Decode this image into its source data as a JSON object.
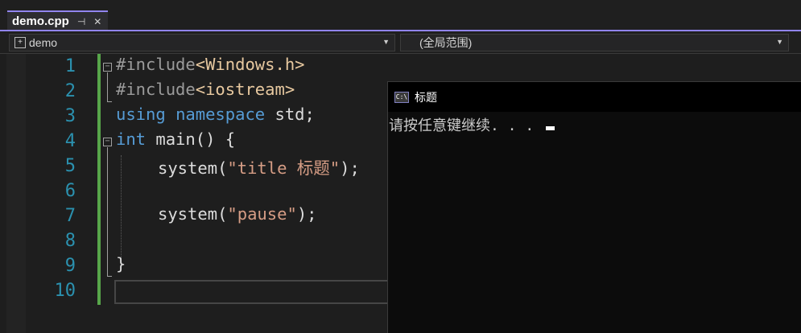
{
  "tab": {
    "title": "demo.cpp",
    "pin_icon": "pin-icon",
    "close_icon": "close-icon",
    "pin_glyph": "⊣",
    "close_glyph": "✕"
  },
  "navbar": {
    "project": "demo",
    "scope": "(全局范围)",
    "project_icon": "project-icon"
  },
  "editor": {
    "line_numbers": [
      "1",
      "2",
      "3",
      "4",
      "5",
      "6",
      "7",
      "8",
      "9",
      "10"
    ],
    "lines": [
      {
        "pp": "#include",
        "inc": "<Windows.h>"
      },
      {
        "pp": "#include",
        "inc": "<iostream>"
      },
      {
        "kw1": "using",
        "kw2": "namespace",
        "rest": " std;"
      },
      {
        "kw": "int",
        "rest": " main() {"
      },
      {
        "fn": "system",
        "open": "(",
        "str": "\"title 标题\"",
        "close": ");"
      },
      {},
      {
        "fn": "system",
        "open": "(",
        "str": "\"pause\"",
        "close": ");"
      },
      {},
      {
        "rest": "}"
      },
      {}
    ],
    "colors": {
      "keyword": "#569cd6",
      "string": "#d69d85",
      "line_number": "#2b91af",
      "change_bar": "#57a64a"
    }
  },
  "console": {
    "title": "标题",
    "icon": "console-icon",
    "icon_glyph": "C:\\",
    "output": "请按任意键继续. . . "
  }
}
